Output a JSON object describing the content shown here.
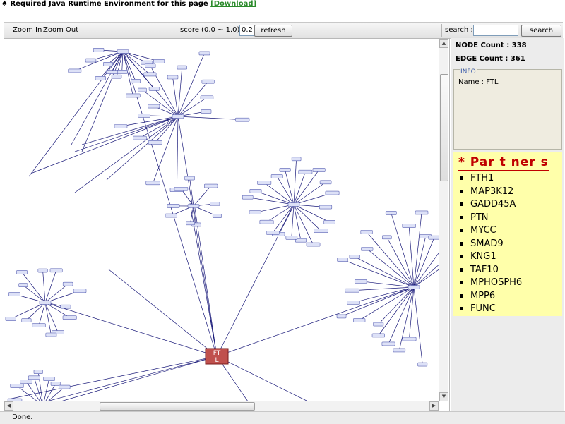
{
  "notice": {
    "bullet_glyph": "♠",
    "text": "Required Java Runtime Environment for this page",
    "download_label": "[Download]"
  },
  "toolbar": {
    "zoom_in": "Zoom In",
    "zoom_out": "Zoom Out",
    "score_label": "score (0.0 ~ 1.0) :",
    "score_value": "0.2",
    "refresh": "refresh",
    "search_label": "search :",
    "search_button": "search",
    "search_value": ""
  },
  "graph": {
    "center_label_top": "FT",
    "center_label_bottom": "L",
    "center_color": "#c0504d",
    "edge_color": "#1a1a7a",
    "node_fill": "#dde1f7",
    "node_border": "#5b63b4"
  },
  "panel": {
    "node_count": "NODE Count : 338",
    "edge_count": "EDGE Count : 361",
    "info_title": "INFO",
    "info_name": "Name : FTL",
    "partners_title": "* Par t ner s",
    "partners": [
      "FTH1",
      "MAP3K12",
      "GADD45A",
      "PTN",
      "MYCC",
      "SMAD9",
      "KNG1",
      "TAF10",
      "MPHOSPH6",
      "MPP6",
      "FUNC"
    ]
  },
  "status": {
    "text": "Done."
  }
}
